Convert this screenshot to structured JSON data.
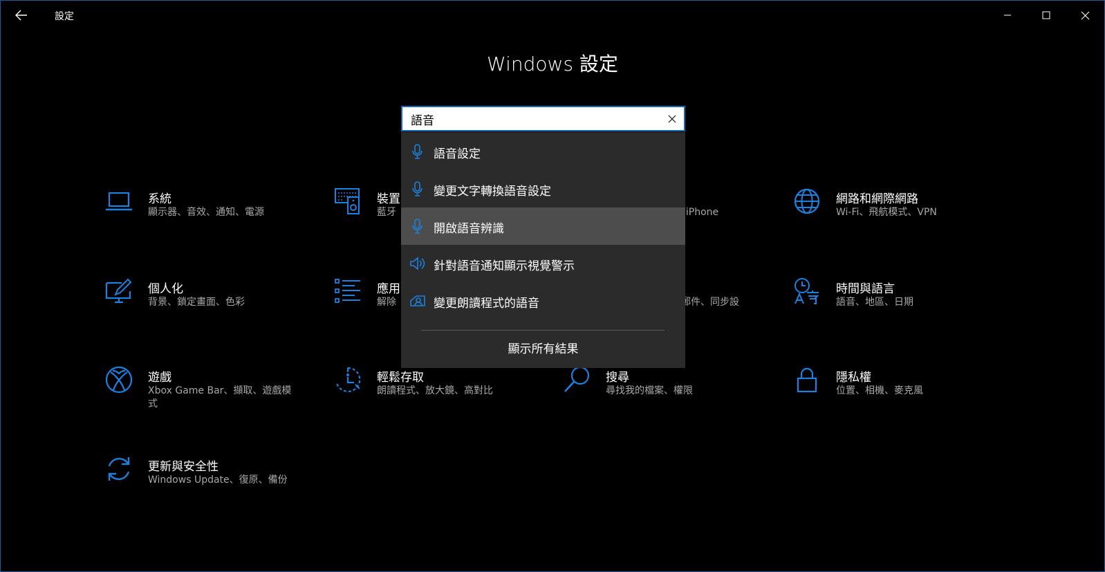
{
  "app": {
    "title": "設定"
  },
  "page": {
    "title": "Windows 設定"
  },
  "search": {
    "value": "語音"
  },
  "suggestions": [
    {
      "label": "語音設定",
      "icon": "microphone-icon"
    },
    {
      "label": "變更文字轉換語音設定",
      "icon": "microphone-icon"
    },
    {
      "label": "開啟語音辨識",
      "icon": "microphone-icon"
    },
    {
      "label": "針對語音通知顯示視覺警示",
      "icon": "speaker-icon"
    },
    {
      "label": "變更朗讀程式的語音",
      "icon": "narrator-icon"
    }
  ],
  "show_all": "顯示所有結果",
  "categories": [
    {
      "name": "系統",
      "desc": "顯示器、音效、通知、電源",
      "icon": "laptop-icon"
    },
    {
      "name": "裝置",
      "desc": "藍牙",
      "icon": "devices-icon"
    },
    {
      "name": "",
      "desc": "d、iPhone",
      "icon": "phone-icon"
    },
    {
      "name": "網路和網際網路",
      "desc": "Wi-Fi、飛航模式、VPN",
      "icon": "globe-icon"
    },
    {
      "name": "個人化",
      "desc": "背景、鎖定畫面、色彩",
      "icon": "personalization-icon"
    },
    {
      "name": "應用",
      "desc": "解除",
      "icon": "apps-icon"
    },
    {
      "name": "",
      "desc": "郵件、同步設",
      "icon": "accounts-icon"
    },
    {
      "name": "時間與語言",
      "desc": "語音、地區、日期",
      "icon": "time-language-icon"
    },
    {
      "name": "遊戲",
      "desc": "Xbox Game Bar、擷取、遊戲模式",
      "icon": "xbox-icon"
    },
    {
      "name": "輕鬆存取",
      "desc": "朗讀程式、放大鏡、高對比",
      "icon": "ease-of-access-icon"
    },
    {
      "name": "搜尋",
      "desc": "尋找我的檔案、權限",
      "icon": "search-icon"
    },
    {
      "name": "隱私權",
      "desc": "位置、相機、麥克風",
      "icon": "lock-icon"
    },
    {
      "name": "更新與安全性",
      "desc": "Windows Update、復原、備份",
      "icon": "sync-icon"
    }
  ],
  "colors": {
    "accent": "#0f6cbd",
    "icon_blue": "#1a82e2",
    "dropdown_bg": "#2b2b2b",
    "highlight": "#4d4d4d"
  }
}
